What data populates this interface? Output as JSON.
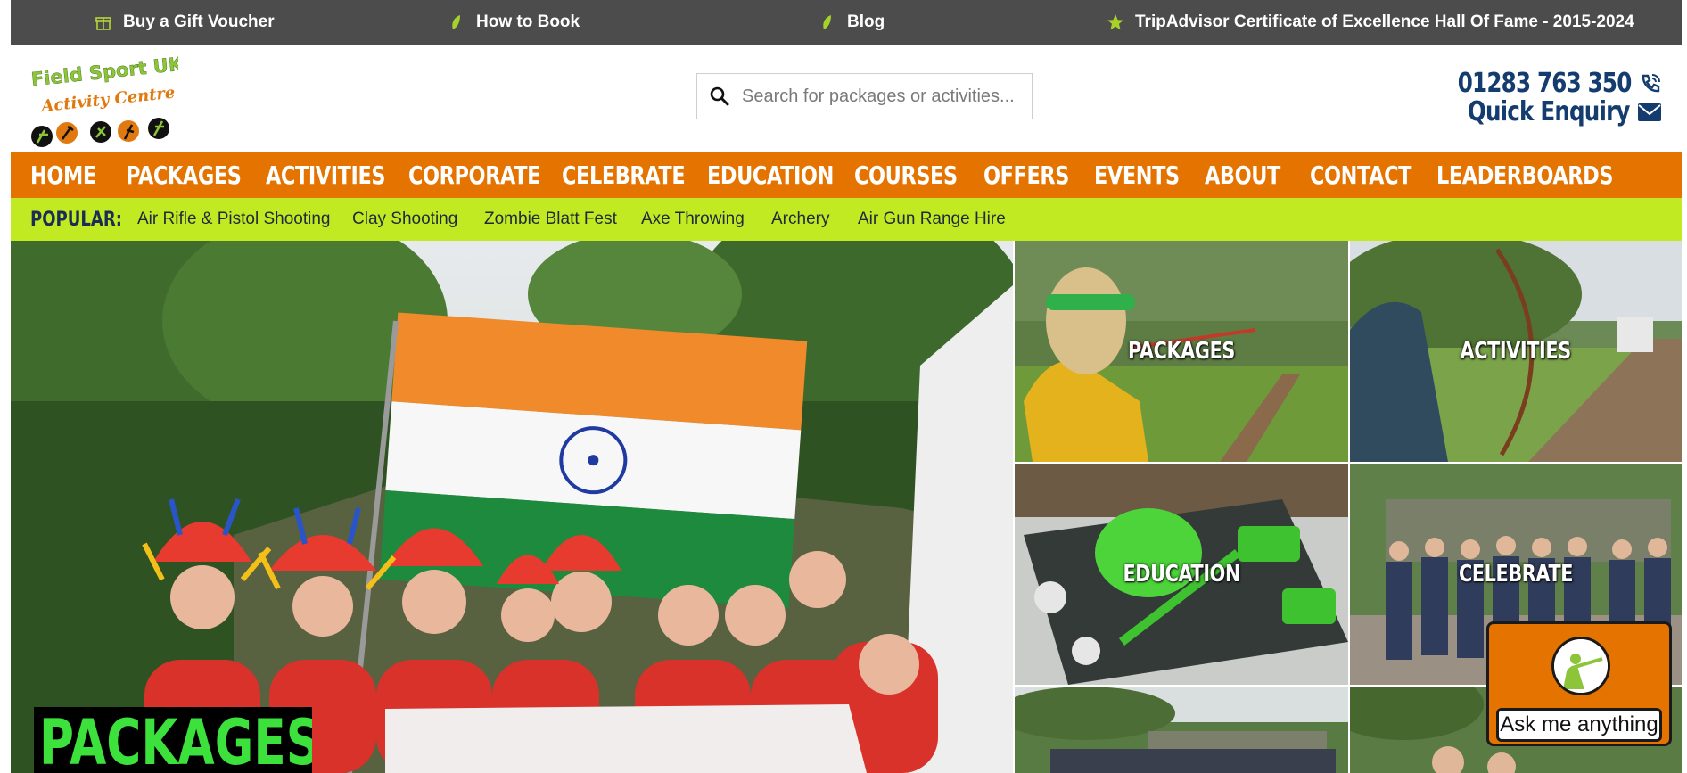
{
  "topbar": {
    "items": [
      {
        "label": "Buy a Gift Voucher",
        "icon": "gift-icon"
      },
      {
        "label": "How to Book",
        "icon": "leaf-icon"
      },
      {
        "label": "Blog",
        "icon": "leaf-icon"
      },
      {
        "label": "TripAdvisor Certificate of Excellence Hall Of Fame - 2015-2024",
        "icon": "star-icon"
      }
    ],
    "bg": "#4c4c4c"
  },
  "logo": {
    "line1": "Field Sport UK",
    "line2": "Activity Centre"
  },
  "search": {
    "placeholder": "Search for packages or activities..."
  },
  "contact": {
    "phone": "01283 763 350",
    "enquiry": "Quick Enquiry"
  },
  "nav": {
    "items": [
      "HOME",
      "PACKAGES",
      "ACTIVITIES",
      "CORPORATE",
      "CELEBRATE",
      "EDUCATION",
      "COURSES",
      "OFFERS",
      "EVENTS",
      "ABOUT",
      "CONTACT",
      "LEADERBOARDS"
    ],
    "bg": "#e57300"
  },
  "popular": {
    "label": "POPULAR:",
    "items": [
      "Air Rifle & Pistol Shooting",
      "Clay Shooting",
      "Zombie Blatt Fest",
      "Axe Throwing",
      "Archery",
      "Air Gun Range Hire"
    ],
    "bg": "#c2ea22"
  },
  "hero": {
    "title": "PACKAGES",
    "title_color": "#3ce13c"
  },
  "tiles": [
    "PACKAGES",
    "ACTIVITIES",
    "EDUCATION",
    "CELEBRATE"
  ],
  "chat": {
    "label": "Ask me anything"
  }
}
